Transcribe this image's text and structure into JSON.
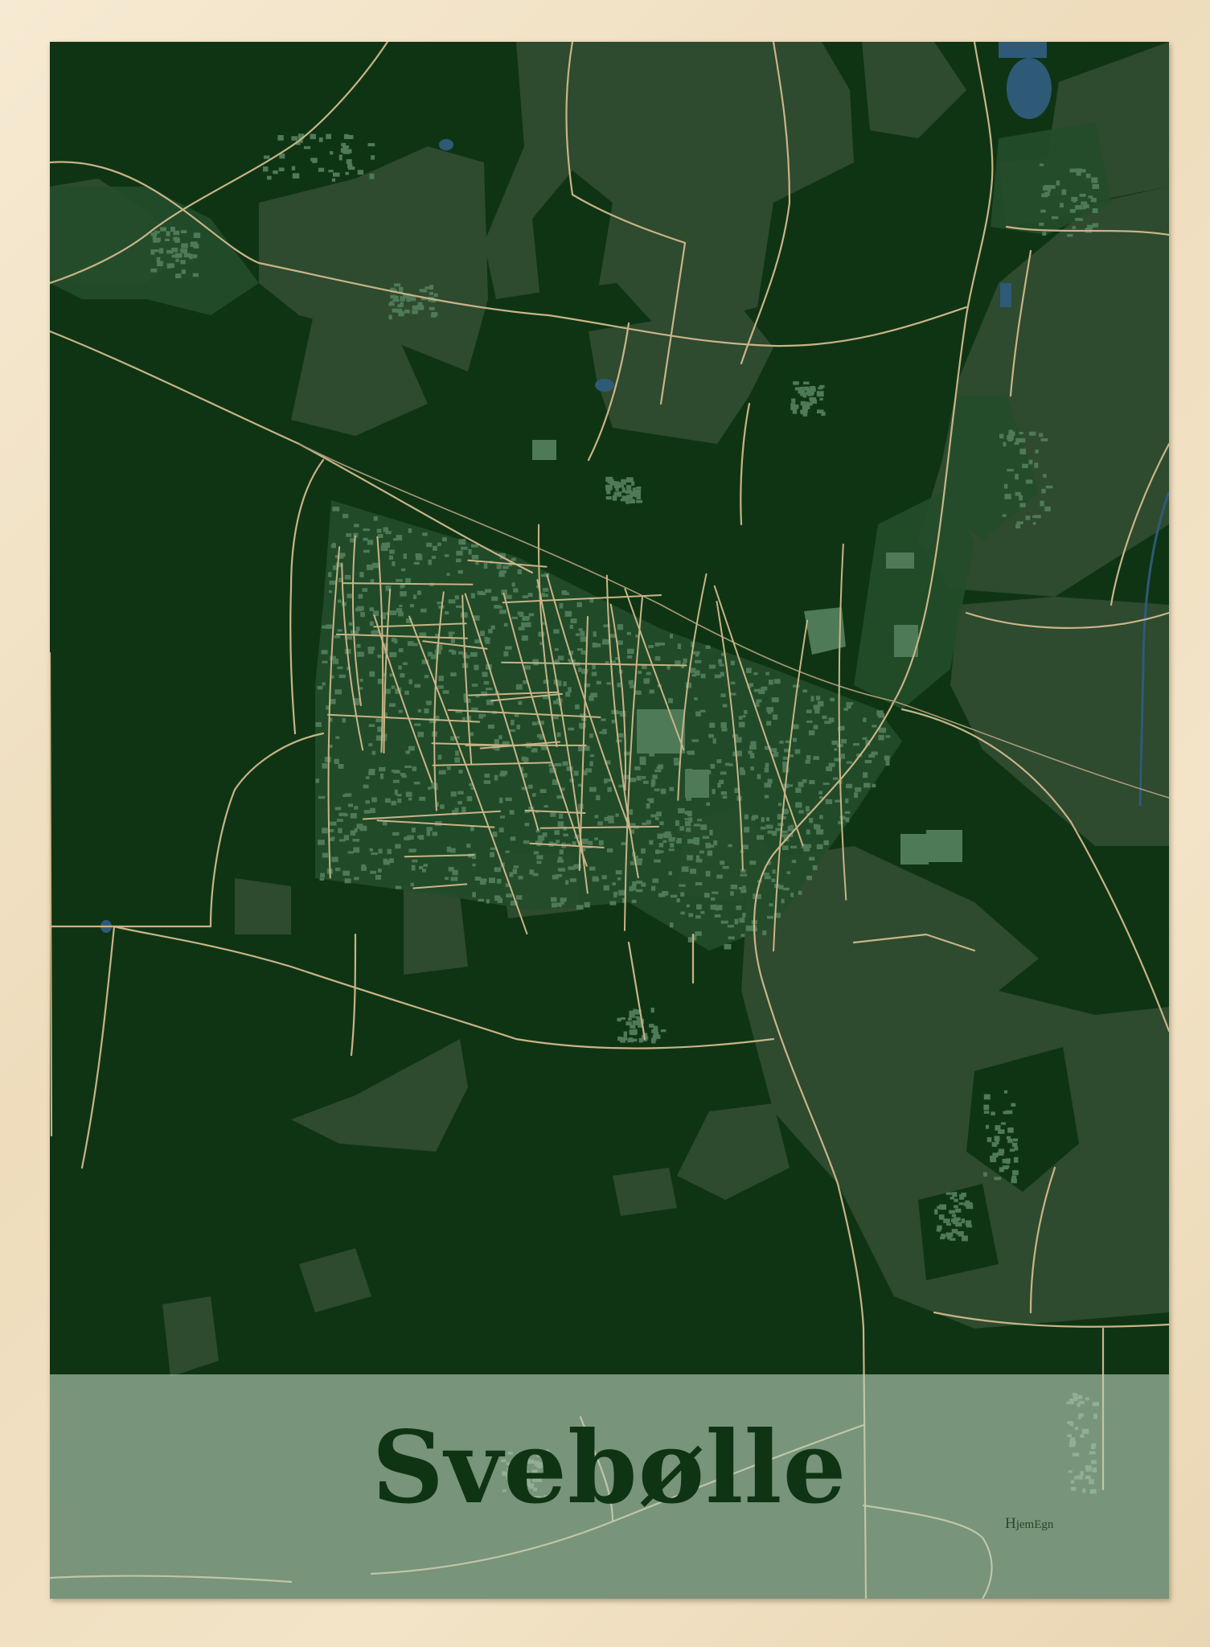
{
  "poster": {
    "title": "Svebølle",
    "brand": "HjemEgn"
  },
  "colors": {
    "frame": "#f1e3c8",
    "background": "#0f3414",
    "fields": "#2e4a2f",
    "buildings": "#4f7a57",
    "roads": "#c8b487",
    "water": "#2e5a78",
    "title_band": "#b9cfbb",
    "title_text": "#0f3414"
  },
  "icons": [
    "town-map"
  ]
}
